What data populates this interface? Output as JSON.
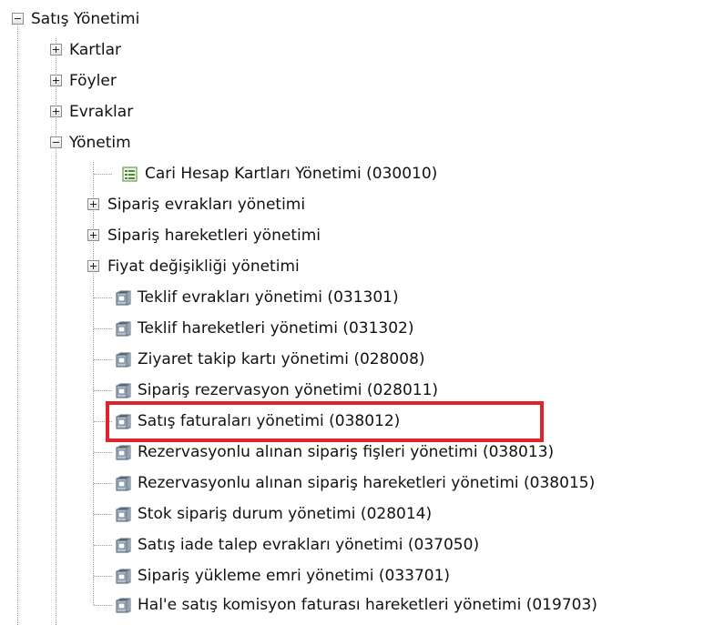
{
  "tree": {
    "root": {
      "label": "Satış Yönetimi",
      "expanded": true
    },
    "level1": [
      {
        "label": "Kartlar",
        "expanded": false
      },
      {
        "label": "Föyler",
        "expanded": false
      },
      {
        "label": "Evraklar",
        "expanded": false
      },
      {
        "label": "Yönetim",
        "expanded": true
      }
    ],
    "yonetim_children": [
      {
        "label": "Cari Hesap Kartları Yönetimi (030010)",
        "type": "form",
        "icon": "form-icon"
      },
      {
        "label": "Sipariş evrakları yönetimi",
        "type": "folder",
        "expanded": false
      },
      {
        "label": "Sipariş hareketleri yönetimi",
        "type": "folder",
        "expanded": false
      },
      {
        "label": "Fiyat değişikliği yönetimi",
        "type": "folder",
        "expanded": false
      },
      {
        "label": "Teklif evrakları yönetimi (031301)",
        "type": "report",
        "icon": "document-stack-icon"
      },
      {
        "label": "Teklif hareketleri yönetimi (031302)",
        "type": "report",
        "icon": "document-stack-icon"
      },
      {
        "label": "Ziyaret takip kartı yönetimi (028008)",
        "type": "report",
        "icon": "document-stack-icon"
      },
      {
        "label": "Sipariş rezervasyon yönetimi (028011)",
        "type": "report",
        "icon": "document-stack-icon"
      },
      {
        "label": "Satış faturaları yönetimi (038012)",
        "type": "report",
        "icon": "document-stack-icon",
        "highlighted": true
      },
      {
        "label": "Rezervasyonlu alınan sipariş fişleri yönetimi (038013)",
        "type": "report",
        "icon": "document-stack-icon"
      },
      {
        "label": "Rezervasyonlu alınan sipariş hareketleri yönetimi (038015)",
        "type": "report",
        "icon": "document-stack-icon"
      },
      {
        "label": "Stok sipariş durum yönetimi (028014)",
        "type": "report",
        "icon": "document-stack-icon"
      },
      {
        "label": "Satış iade talep evrakları yönetimi (037050)",
        "type": "report",
        "icon": "document-stack-icon"
      },
      {
        "label": "Sipariş yükleme emri yönetimi (033701)",
        "type": "report",
        "icon": "document-stack-icon"
      },
      {
        "label": "Hal'e satış komisyon faturası hareketleri yönetimi (019703)",
        "type": "report",
        "icon": "document-stack-icon"
      }
    ]
  },
  "colors": {
    "highlight_border": "#e0232a",
    "tree_lines": "#9a9a9a",
    "text": "#111111"
  }
}
